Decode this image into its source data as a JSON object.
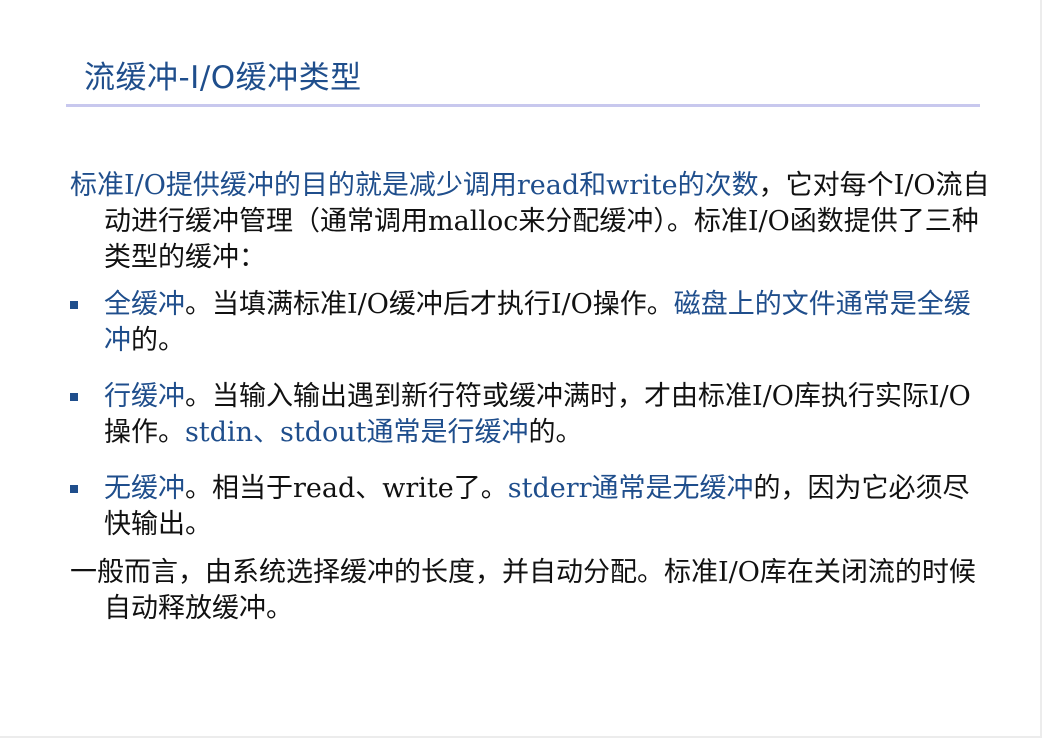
{
  "title": "流缓冲-I/O缓冲类型",
  "intro": {
    "part1": "标准I/O提供缓冲的目的就是减少调用read和write的次数",
    "part2": "，它对每个I/O流自动进行缓冲管理（通常调用malloc来分配缓冲）。标准I/O函数提供了三种类型的缓冲："
  },
  "bullets": [
    {
      "term": "全缓冲",
      "text": "。当填满标准I/O缓冲后才执行I/O操作。",
      "highlight": "磁盘上的文件通常是全缓冲",
      "tail": "的。"
    },
    {
      "term": "行缓冲",
      "text": "。当输入输出遇到新行符或缓冲满时，才由标准I/O库执行实际I/O操作。",
      "highlight": "stdin、stdout通常是行缓冲",
      "tail": "的。"
    },
    {
      "term": "无缓冲",
      "text": "。相当于read、write了。",
      "highlight": "stderr通常是无缓冲",
      "tail": "的，因为它必须尽快输出。"
    }
  ],
  "closing": "一般而言，由系统选择缓冲的长度，并自动分配。标准I/O库在关闭流的时候自动释放缓冲。",
  "colors": {
    "accent": "#1f4e8c",
    "title_rule": "#c8c8ee",
    "text": "#111111"
  }
}
